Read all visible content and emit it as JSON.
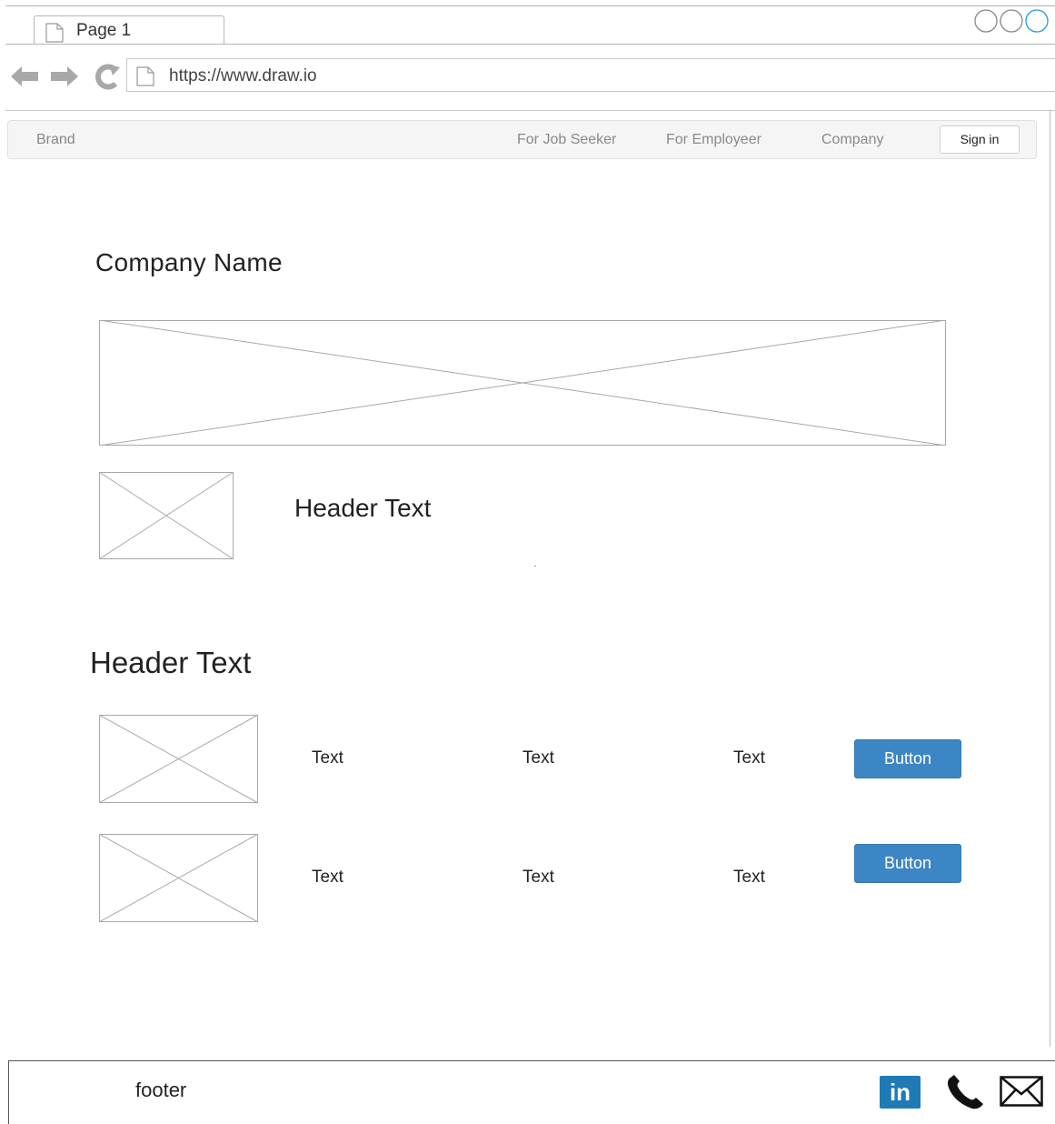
{
  "browser": {
    "tab_title": "Page 1",
    "url": "https://www.draw.io"
  },
  "navbar": {
    "brand": "Brand",
    "links": [
      "For Job Seeker",
      "For Employeer",
      "Company"
    ],
    "sign_in": "Sign in"
  },
  "content": {
    "company_name": "Company Name",
    "header_1": "Header Text",
    "header_2": "Header Text",
    "rows": [
      {
        "texts": [
          "Text",
          "Text",
          "Text"
        ],
        "button": "Button"
      },
      {
        "texts": [
          "Text",
          "Text",
          "Text"
        ],
        "button": "Button"
      }
    ]
  },
  "footer": {
    "label": "footer",
    "linkedin": "in",
    "icons": [
      "linkedin-icon",
      "phone-icon",
      "mail-icon"
    ]
  },
  "colors": {
    "button_blue": "#3d86c6",
    "linkedin_blue": "#1f7ab6"
  }
}
